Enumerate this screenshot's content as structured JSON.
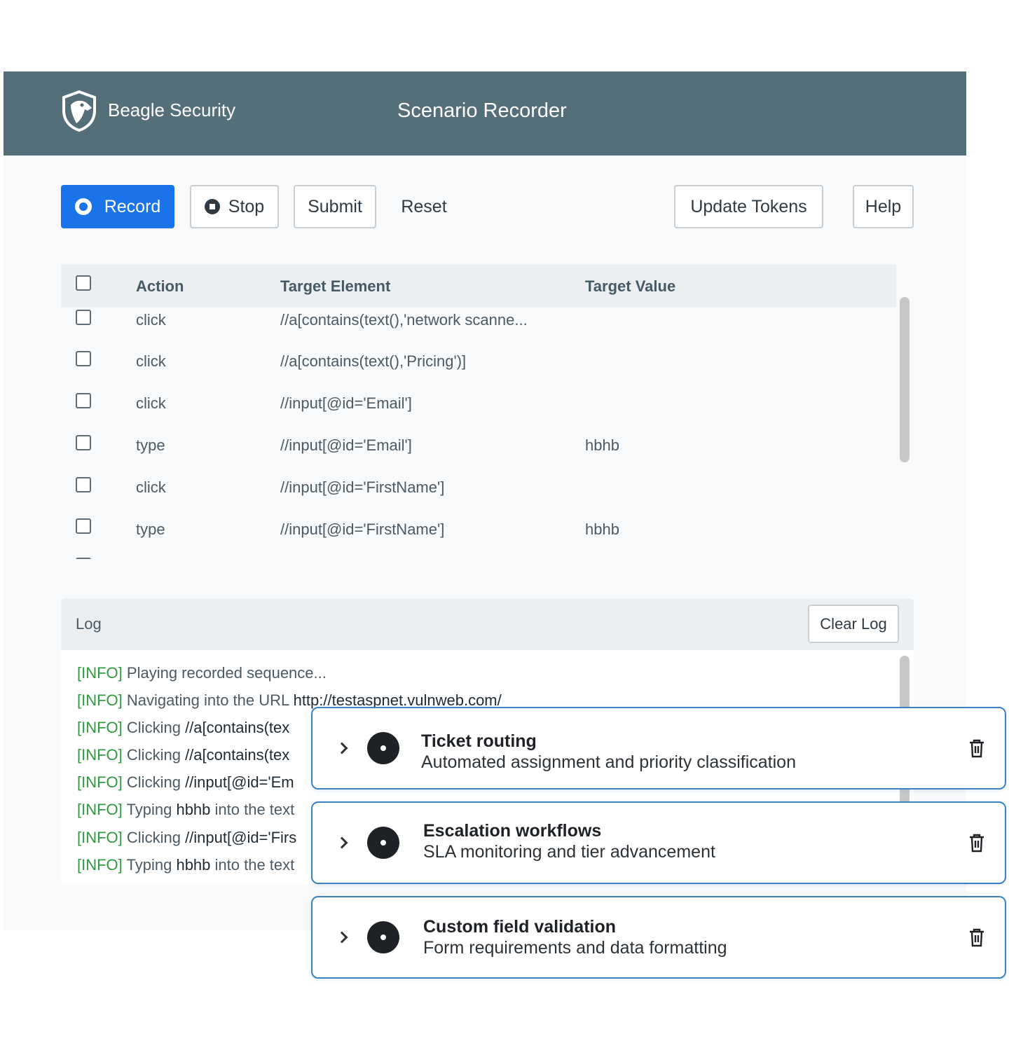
{
  "header": {
    "brand": "Beagle Security",
    "title": "Scenario Recorder"
  },
  "toolbar": {
    "record_label": "Record",
    "stop_label": "Stop",
    "submit_label": "Submit",
    "reset_label": "Reset",
    "update_tokens_label": "Update Tokens",
    "help_label": "Help"
  },
  "table": {
    "columns": [
      "Action",
      "Target Element",
      "Target Value"
    ],
    "rows": [
      {
        "action": "click",
        "target": "//a[contains(text(),'network scanne...",
        "value": ""
      },
      {
        "action": "click",
        "target": "//a[contains(text(),'Pricing')]",
        "value": ""
      },
      {
        "action": "click",
        "target": "//input[@id='Email']",
        "value": ""
      },
      {
        "action": "type",
        "target": "//input[@id='Email']",
        "value": "hbhb"
      },
      {
        "action": "click",
        "target": "//input[@id='FirstName']",
        "value": ""
      },
      {
        "action": "type",
        "target": "//input[@id='FirstName']",
        "value": "hbhb"
      }
    ]
  },
  "log": {
    "title": "Log",
    "clear_label": "Clear Log",
    "lines": [
      {
        "tag": "[INFO]",
        "msg": "Playing recorded sequence...",
        "detail": ""
      },
      {
        "tag": "[INFO]",
        "msg": "Navigating into the URL",
        "detail": "http://testaspnet.vulnweb.com/"
      },
      {
        "tag": "[INFO]",
        "msg": "Clicking",
        "detail": "//a[contains(tex"
      },
      {
        "tag": "[INFO]",
        "msg": "Clicking",
        "detail": "//a[contains(tex"
      },
      {
        "tag": "[INFO]",
        "msg": "Clicking",
        "detail": "//input[@id='Em"
      },
      {
        "tag": "[INFO]",
        "msg": "Typing",
        "detail": "hbhb",
        "tail": "into the text"
      },
      {
        "tag": "[INFO]",
        "msg": "Clicking",
        "detail": "//input[@id='Firs"
      },
      {
        "tag": "[INFO]",
        "msg": "Typing",
        "detail": "hbhb",
        "tail": "into the text"
      }
    ]
  },
  "cards": [
    {
      "title": "Ticket routing",
      "subtitle": "Automated assignment and priority classification"
    },
    {
      "title": "Escalation workflows",
      "subtitle": "SLA monitoring and tier advancement"
    },
    {
      "title": "Custom field validation",
      "subtitle": "Form requirements and data formatting"
    }
  ],
  "icons": {
    "logo": "beagle-shield-logo",
    "record": "record-circle-icon",
    "stop": "stop-circle-icon",
    "card_expand": "chevron-right-icon",
    "card_status": "disc-icon",
    "card_delete": "trash-icon"
  },
  "colors": {
    "header_bg": "#546e7a",
    "record_blue": "#1a73e8",
    "log_tag_green": "#2e9b3e",
    "card_border": "#3b82c4"
  }
}
